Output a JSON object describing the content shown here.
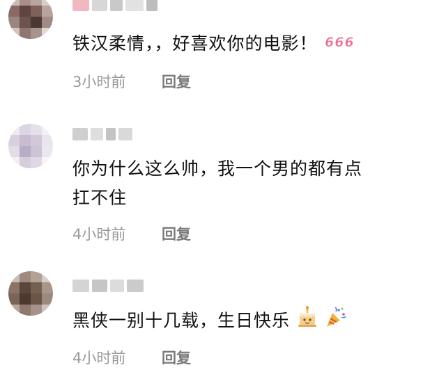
{
  "comments": [
    {
      "text": "铁汉柔情，，好喜欢你的电影！",
      "emoji": "666-icon",
      "time": "3小时前",
      "reply_label": "回复"
    },
    {
      "text": "你为什么这么帅，我一个男的都有点扛不住",
      "time": "4小时前",
      "reply_label": "回复"
    },
    {
      "text": "黑侠一别十几载，生日快乐",
      "emoji": [
        "birthday-cake-icon",
        "party-popper-icon"
      ],
      "time": "4小时前",
      "reply_label": "回复"
    }
  ]
}
